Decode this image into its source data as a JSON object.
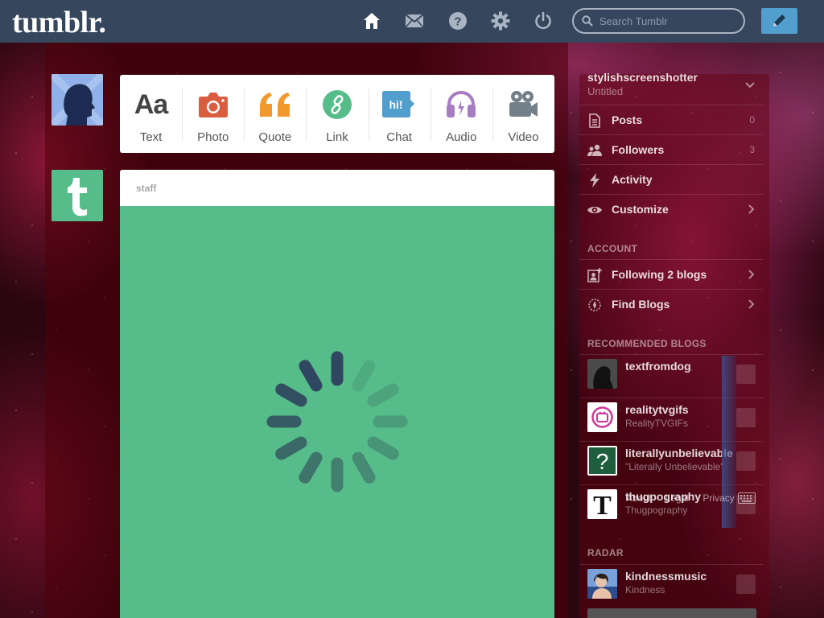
{
  "header": {
    "logo": "tumblr.",
    "search_placeholder": "Search Tumblr",
    "nav_icons": [
      "home-icon",
      "mail-icon",
      "help-icon",
      "gear-icon",
      "power-icon"
    ],
    "compose_icon": "pencil-icon"
  },
  "post_types": [
    {
      "label": "Text",
      "icon": "text-icon",
      "color": "#444444"
    },
    {
      "label": "Photo",
      "icon": "camera-icon",
      "color": "#d95e40"
    },
    {
      "label": "Quote",
      "icon": "quote-icon",
      "color": "#f2992e"
    },
    {
      "label": "Link",
      "icon": "link-icon",
      "color": "#56bc8a"
    },
    {
      "label": "Chat",
      "icon": "chat-icon",
      "color": "#529ecc",
      "badge": "hi!"
    },
    {
      "label": "Audio",
      "icon": "headphones-icon",
      "color": "#a77dc2"
    },
    {
      "label": "Video",
      "icon": "video-camera-icon",
      "color": "#748089"
    }
  ],
  "post": {
    "author": "staff",
    "body_color": "#56bc8a",
    "loading": true
  },
  "sidebar": {
    "blog": {
      "name": "stylishscreenshotter",
      "title": "Untitled"
    },
    "menu": [
      {
        "label": "Posts",
        "count": "0",
        "icon": "document-icon"
      },
      {
        "label": "Followers",
        "count": "3",
        "icon": "people-icon"
      },
      {
        "label": "Activity",
        "count": "",
        "icon": "lightning-icon"
      },
      {
        "label": "Customize",
        "count": "",
        "icon": "eye-icon"
      }
    ],
    "account_label": "ACCOUNT",
    "account": [
      {
        "label": "Following 2 blogs",
        "icon": "add-person-icon"
      },
      {
        "label": "Find Blogs",
        "icon": "compass-icon"
      }
    ],
    "recommended_label": "RECOMMENDED BLOGS",
    "recommended": [
      {
        "name": "textfromdog",
        "subtitle": ""
      },
      {
        "name": "realitytvgifs",
        "subtitle": "RealityTVGIFs"
      },
      {
        "name": "literallyunbelievable",
        "subtitle": "\"Literally Unbelievable\""
      },
      {
        "name": "thugpography",
        "subtitle": "Thugpography"
      }
    ],
    "footer": {
      "about": "About",
      "legal": "Legal",
      "privacy": "Privacy"
    },
    "radar_label": "RADAR",
    "radar": {
      "name": "kindnessmusic",
      "subtitle": "Kindness"
    }
  }
}
